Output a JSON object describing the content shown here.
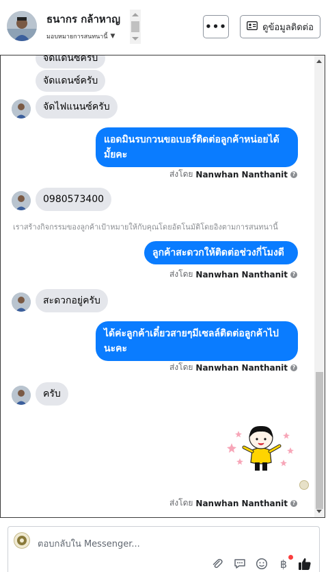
{
  "header": {
    "name": "ธนากร กล้าหาญ",
    "assign_label": "มอบหมายการสนทนานี้",
    "more_label": "•••",
    "contact_button": "ดูข้อมูลติดต่อ"
  },
  "messages": {
    "m0": "จัดแดนซ์ครับ",
    "m1": "จัดแดนซ์ครับ",
    "m2": "จัดไฟแนนซ์ครับ",
    "m3": "แอดมินรบกวนขอเบอร์ติดต่อลูกค้าหน่อยได้มั้ยคะ",
    "m4": "0980573400",
    "m5": "ลูกค้าสะดวกให้ติดต่อช่วงกี่โมงดีคะ",
    "m6": "สะดวกอยู่ครับ",
    "m7": "ได้ค่ะลูกค้าเดี๋ยวสายๆมีเซลล์ติดต่อลูกค้าไปนะคะ",
    "m8": "ครับ"
  },
  "sent_by": {
    "prefix": "ส่งโดย",
    "name": "Nanwhan Nanthanit"
  },
  "system_message": "เราสร้างกิจกรรมของลูกค้าเป้าหมายให้กับคุณโดยอัตโนมัติโดยอิงตามการสนทนานี้",
  "composer": {
    "placeholder": "ตอบกลับใน Messenger..."
  },
  "colors": {
    "outgoing_bubble": "#0a7cff",
    "incoming_bubble": "#e4e6eb",
    "like": "#1c1e21"
  },
  "icons": {
    "contact": "id-card-icon",
    "attach": "paperclip-icon",
    "saved_replies": "chat-bubble-icon",
    "emoji": "smile-icon",
    "payment": "baht-icon",
    "like": "thumbs-up-icon"
  }
}
